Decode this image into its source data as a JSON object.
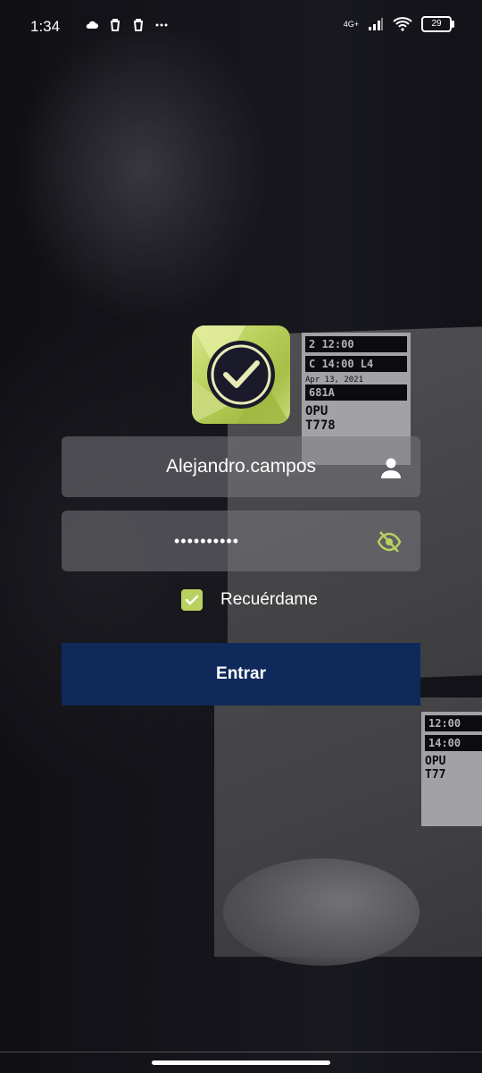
{
  "status_bar": {
    "time": "1:34",
    "network": "4G+",
    "battery": "29"
  },
  "background": {
    "label_a": [
      "2 12:00",
      "C 14:00 L4",
      "Apr 13, 2021",
      "681A",
      "OPU",
      "T778"
    ],
    "label_b": [
      "12:00",
      "14:00",
      "OPU",
      "T77"
    ]
  },
  "login": {
    "username": "Alejandro.campos",
    "password_masked": "••••••••••",
    "remember_label": "Recuérdame",
    "remember_checked": true,
    "submit_label": "Entrar"
  },
  "icons": {
    "user_field": "person-icon",
    "password_field": "eye-off-icon",
    "logo": "check-badge-icon"
  },
  "colors": {
    "accent": "#b9d15e",
    "button": "#0f2a5a"
  }
}
